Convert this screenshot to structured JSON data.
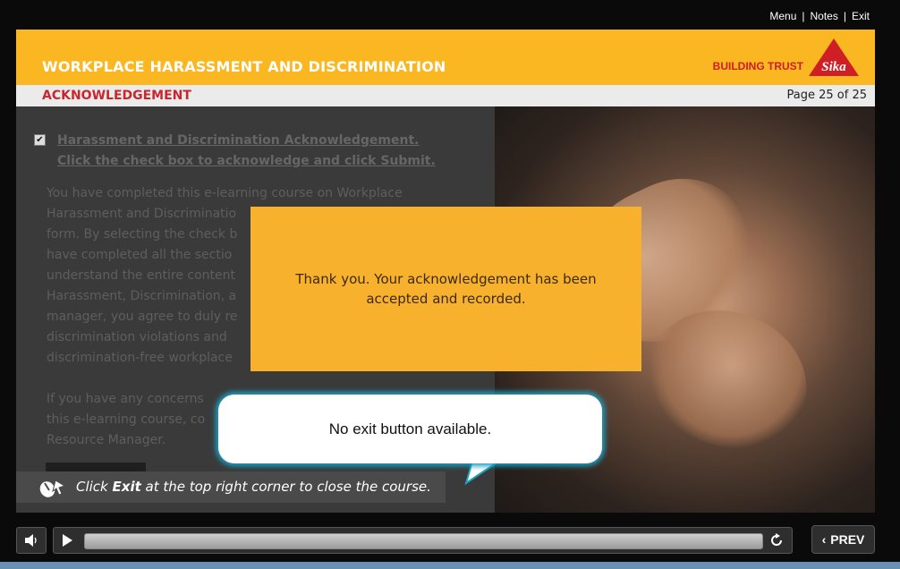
{
  "top_menu": {
    "menu": "Menu",
    "notes": "Notes",
    "exit": "Exit"
  },
  "header": {
    "course_title": "WORKPLACE HARASSMENT AND DISCRIMINATION",
    "brand_tagline": "BUILDING TRUST",
    "brand_logo": "Sika"
  },
  "subheader": {
    "section": "ACKNOWLEDGEMENT",
    "page": "Page 25 of 25"
  },
  "content": {
    "ack_heading_line1": "Harassment and Discrimination Acknowledgement.",
    "ack_heading_line2": "Click the check box to acknowledge and click Submit.",
    "para_lines": [
      "You have completed this e-learning course on Workplace",
      "Harassment and Discriminatio",
      "form. By selecting the check b",
      "have completed all the sectio",
      "understand the entire content",
      "Harassment, Discrimination, a",
      "manager, you agree to duly re",
      "discrimination violations and",
      "discrimination-free workplace"
    ],
    "para2_lines": [
      "If you have any concerns",
      "this e-learning course, co",
      "Resource Manager."
    ]
  },
  "hint": {
    "prefix": "Click ",
    "bold": "Exit",
    "suffix": " at the top right corner to close the course."
  },
  "modal": {
    "line1": "Thank you. Your acknowledgement has been",
    "line2": "accepted and recorded."
  },
  "callout": {
    "text": "No exit button available."
  },
  "controls": {
    "prev_label": "PREV",
    "progress": 0
  },
  "colors": {
    "header_bg": "#fbb722",
    "section_red": "#c8272d",
    "modal_bg": "#f7b12c",
    "callout_glow": "#1b9fc1"
  }
}
